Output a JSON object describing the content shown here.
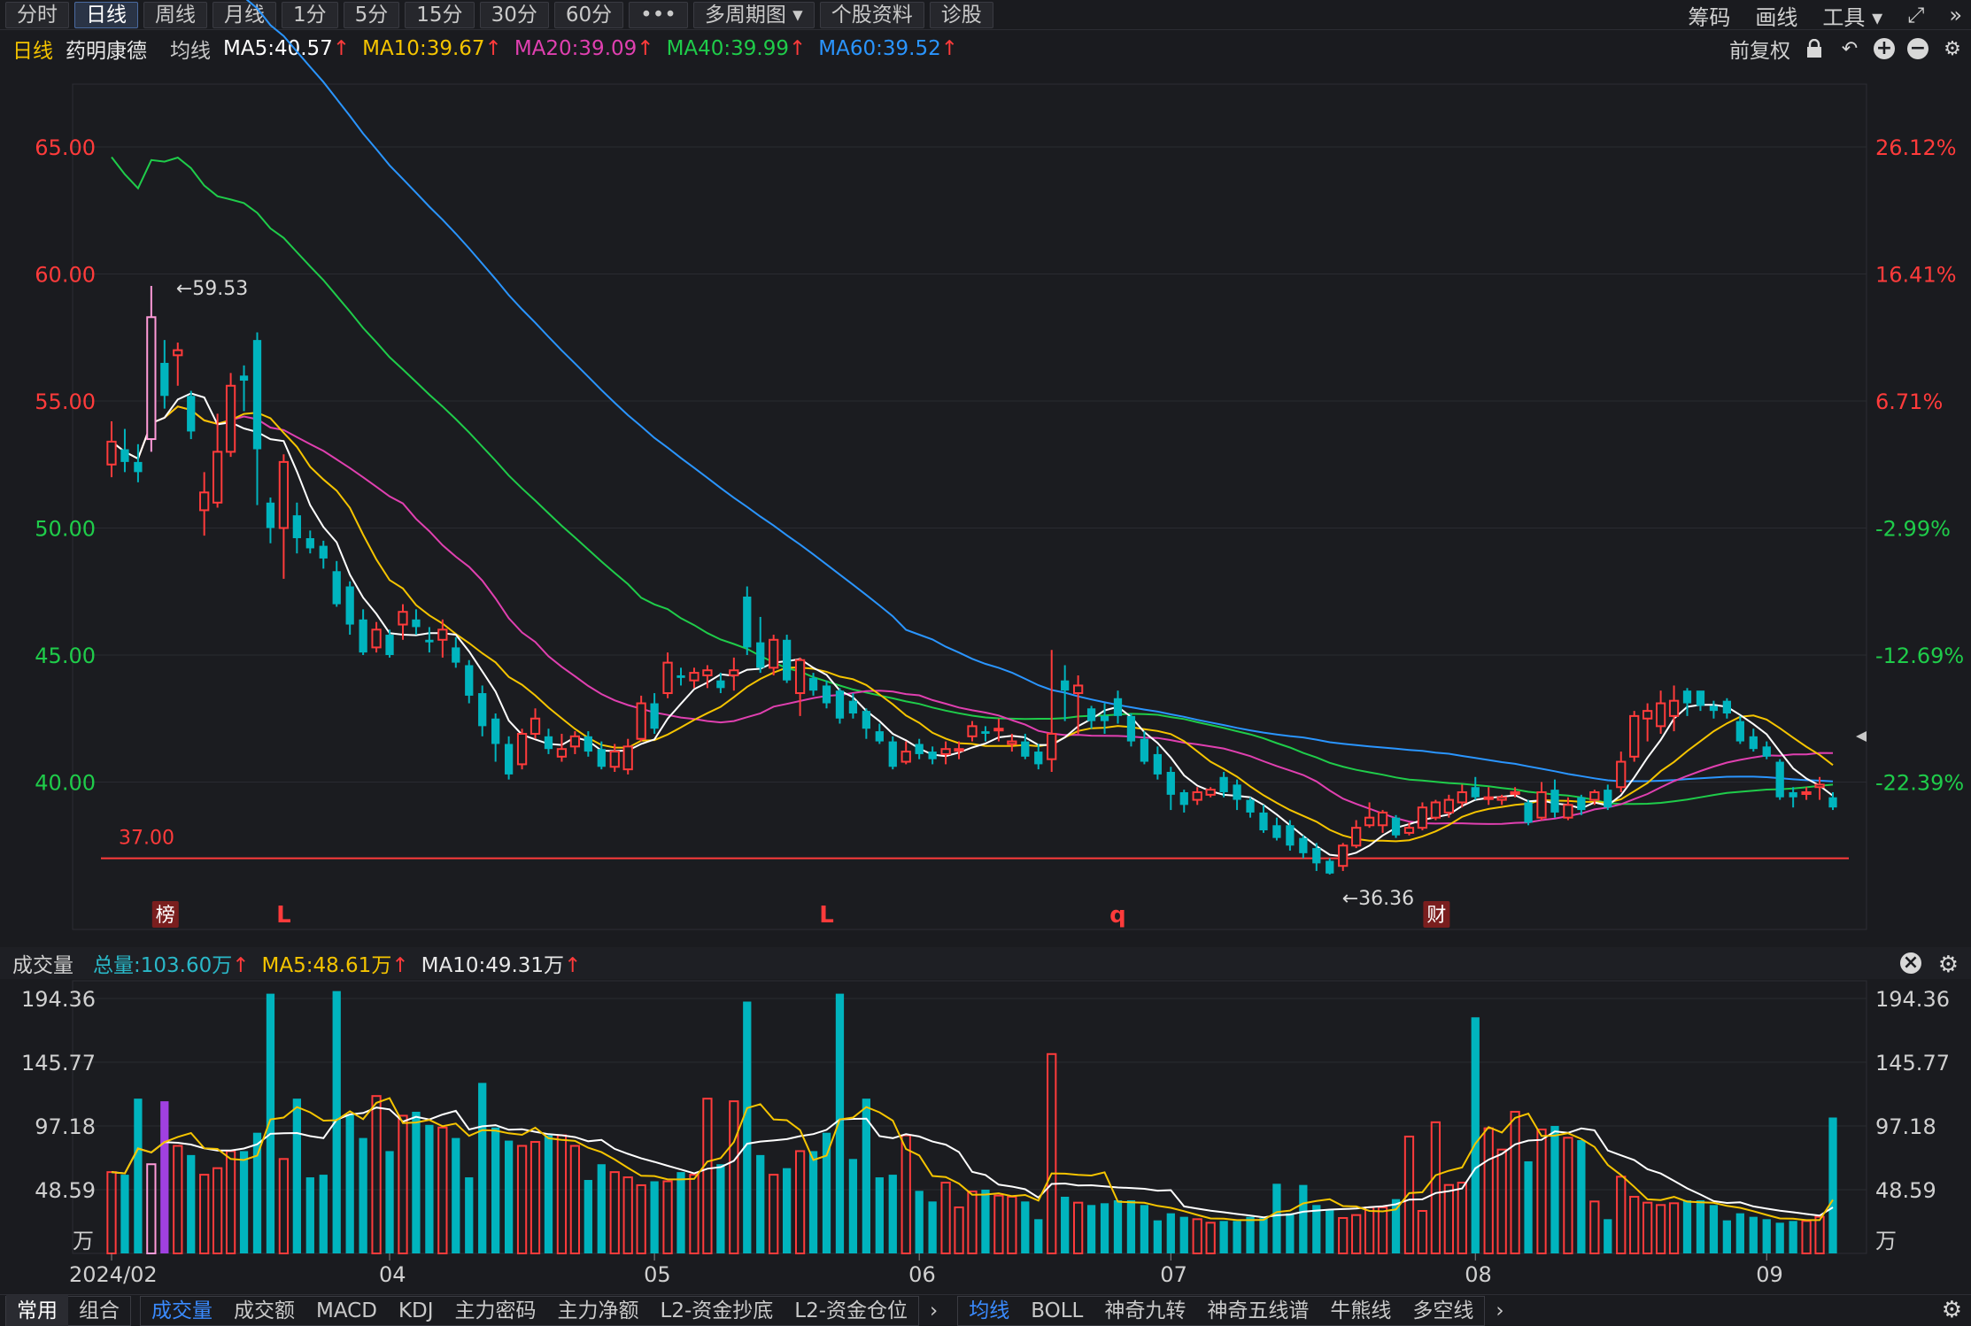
{
  "toolbar": {
    "periods": [
      "分时",
      "日线",
      "周线",
      "月线",
      "1分",
      "5分",
      "15分",
      "30分",
      "60分",
      "•••",
      "多周期图",
      "个股资料",
      "诊股"
    ],
    "active_period": "日线",
    "right": [
      "筹码",
      "画线",
      "工具"
    ]
  },
  "ma_row": {
    "period": "日线",
    "stock": "药明康德",
    "avg_label": "均线",
    "items": [
      {
        "text": "MA5:40.57",
        "color": "#ffffff"
      },
      {
        "text": "MA10:39.67",
        "color": "#f5c400"
      },
      {
        "text": "MA20:39.09",
        "color": "#e040b0"
      },
      {
        "text": "MA40:39.99",
        "color": "#1fcc4a"
      },
      {
        "text": "MA60:39.52",
        "color": "#2a95ff"
      }
    ],
    "adjust": "前复权"
  },
  "volume_header": {
    "label": "成交量",
    "total": "总量:103.60万",
    "ma5": "MA5:48.61万",
    "ma10": "MA10:49.31万"
  },
  "bottom_tabs": {
    "group1": [
      "常用",
      "组合"
    ],
    "group2": [
      "成交量",
      "成交额",
      "MACD",
      "KDJ",
      "主力密码",
      "主力净额",
      "L2-资金抄底",
      "L2-资金仓位"
    ],
    "group3": [
      "均线",
      "BOLL",
      "神奇九转",
      "神奇五线谱",
      "牛熊线",
      "多空线"
    ]
  },
  "colors": {
    "up": "#ff3b3b",
    "down": "#00b4be",
    "ma5": "#ffffff",
    "ma10": "#f5c400",
    "ma20": "#e040b0",
    "ma40": "#1fcc4a",
    "ma60": "#2a95ff"
  },
  "chart_data": {
    "type": "candlestick",
    "price_axis": {
      "ticks": [
        65.0,
        60.0,
        55.0,
        50.0,
        45.0,
        40.0
      ],
      "labels": [
        "65.00",
        "60.00",
        "55.00",
        "50.00",
        "45.00",
        "40.00"
      ]
    },
    "pct_axis": {
      "ticks": [
        26.12,
        16.41,
        6.71,
        -2.99,
        -12.69,
        -22.39
      ],
      "labels": [
        "26.12%",
        "16.41%",
        "6.71%",
        "-2.99%",
        "-12.69%",
        "-22.39%"
      ]
    },
    "support_line": {
      "value": 37.0,
      "label": "37.00"
    },
    "annotations": [
      {
        "text": "←59.53",
        "value": 59.53
      },
      {
        "text": "←36.36",
        "value": 36.36
      }
    ],
    "markers": [
      {
        "text": "榜",
        "boxed": true
      },
      {
        "text": "L",
        "boxed": false
      },
      {
        "text": "L",
        "boxed": false
      },
      {
        "text": "q",
        "boxed": false
      },
      {
        "text": "财",
        "boxed": true
      }
    ],
    "marker_index": [
      4,
      13,
      54,
      76,
      100
    ],
    "x_labels": [
      {
        "i": 0,
        "text": "2024/02"
      },
      {
        "i": 21,
        "text": "04"
      },
      {
        "i": 41,
        "text": "05"
      },
      {
        "i": 61,
        "text": "06"
      },
      {
        "i": 80,
        "text": "07"
      },
      {
        "i": 103,
        "text": "08"
      },
      {
        "i": 125,
        "text": "09"
      }
    ],
    "volume_axis": {
      "ticks": [
        194.36,
        145.77,
        97.18,
        48.59
      ],
      "labels": [
        "194.36",
        "145.77",
        "97.18",
        "48.59"
      ],
      "unit": "万"
    },
    "candles": [
      [
        52.5,
        53.4,
        52.0,
        54.2
      ],
      [
        53.1,
        52.6,
        52.2,
        53.9
      ],
      [
        52.6,
        52.2,
        51.8,
        53.3
      ],
      [
        53.5,
        58.3,
        53.0,
        59.53
      ],
      [
        56.5,
        55.2,
        54.7,
        57.4
      ],
      [
        56.8,
        57.0,
        55.6,
        57.3
      ],
      [
        55.2,
        53.8,
        53.5,
        55.4
      ],
      [
        50.7,
        51.4,
        49.7,
        52.2
      ],
      [
        51.0,
        53.0,
        50.8,
        54.5
      ],
      [
        53.0,
        55.6,
        52.8,
        56.1
      ],
      [
        56.0,
        55.8,
        54.6,
        56.4
      ],
      [
        57.4,
        53.1,
        50.9,
        57.7
      ],
      [
        51.0,
        50.0,
        49.4,
        51.2
      ],
      [
        50.0,
        52.6,
        48.0,
        52.9
      ],
      [
        50.5,
        49.6,
        49.0,
        51.0
      ],
      [
        49.6,
        49.2,
        49.0,
        49.9
      ],
      [
        49.3,
        48.8,
        48.4,
        49.5
      ],
      [
        48.3,
        47.0,
        46.9,
        48.7
      ],
      [
        47.7,
        46.2,
        45.8,
        47.9
      ],
      [
        46.4,
        45.1,
        45.0,
        46.8
      ],
      [
        45.3,
        46.0,
        45.1,
        46.3
      ],
      [
        45.8,
        45.0,
        44.9,
        46.0
      ],
      [
        46.2,
        46.7,
        45.6,
        47.0
      ],
      [
        46.4,
        46.1,
        45.8,
        46.8
      ],
      [
        45.6,
        45.5,
        45.1,
        46.1
      ],
      [
        45.6,
        46.0,
        44.9,
        46.4
      ],
      [
        45.3,
        44.7,
        44.5,
        45.7
      ],
      [
        44.6,
        43.4,
        43.1,
        44.8
      ],
      [
        43.5,
        42.2,
        41.8,
        43.8
      ],
      [
        42.5,
        41.5,
        40.8,
        42.7
      ],
      [
        41.5,
        40.3,
        40.1,
        41.8
      ],
      [
        40.7,
        41.9,
        40.5,
        42.1
      ],
      [
        41.9,
        42.5,
        41.7,
        42.9
      ],
      [
        41.8,
        41.3,
        41.1,
        42.1
      ],
      [
        41.0,
        41.3,
        40.8,
        41.9
      ],
      [
        41.4,
        41.8,
        41.1,
        42.0
      ],
      [
        41.8,
        41.2,
        41.0,
        42.0
      ],
      [
        41.3,
        40.6,
        40.5,
        41.6
      ],
      [
        40.6,
        41.2,
        40.4,
        41.5
      ],
      [
        40.5,
        41.4,
        40.3,
        41.7
      ],
      [
        41.7,
        43.1,
        41.6,
        43.4
      ],
      [
        43.1,
        42.1,
        41.9,
        43.5
      ],
      [
        43.5,
        44.7,
        43.3,
        45.1
      ],
      [
        44.2,
        44.1,
        43.8,
        44.5
      ],
      [
        44.0,
        44.3,
        43.7,
        44.5
      ],
      [
        44.2,
        44.4,
        43.7,
        44.6
      ],
      [
        44.0,
        43.7,
        43.5,
        44.3
      ],
      [
        44.2,
        44.4,
        43.6,
        44.9
      ],
      [
        47.3,
        45.3,
        45.0,
        47.7
      ],
      [
        45.5,
        44.5,
        44.3,
        46.5
      ],
      [
        44.5,
        45.6,
        44.2,
        45.8
      ],
      [
        45.6,
        44.0,
        43.9,
        45.8
      ],
      [
        43.5,
        44.8,
        42.6,
        44.9
      ],
      [
        44.1,
        43.6,
        43.4,
        44.3
      ],
      [
        43.8,
        43.1,
        42.9,
        44.0
      ],
      [
        43.6,
        42.5,
        42.3,
        43.7
      ],
      [
        43.2,
        42.7,
        42.5,
        43.5
      ],
      [
        42.8,
        42.1,
        41.7,
        42.9
      ],
      [
        42.0,
        41.6,
        41.5,
        42.3
      ],
      [
        41.6,
        40.6,
        40.5,
        41.8
      ],
      [
        40.8,
        41.2,
        40.7,
        41.6
      ],
      [
        41.5,
        41.1,
        40.9,
        41.7
      ],
      [
        41.2,
        40.9,
        40.7,
        41.4
      ],
      [
        41.1,
        41.3,
        40.7,
        41.6
      ],
      [
        41.3,
        41.3,
        40.9,
        41.6
      ],
      [
        41.8,
        42.2,
        41.6,
        42.4
      ],
      [
        42.0,
        41.9,
        41.6,
        42.2
      ],
      [
        42.1,
        42.1,
        41.6,
        42.5
      ],
      [
        41.5,
        41.6,
        41.2,
        41.9
      ],
      [
        41.6,
        41.0,
        40.9,
        41.9
      ],
      [
        41.2,
        40.7,
        40.5,
        41.5
      ],
      [
        40.9,
        41.9,
        40.4,
        45.2
      ],
      [
        44.0,
        43.6,
        42.4,
        44.6
      ],
      [
        43.5,
        43.8,
        41.9,
        44.2
      ],
      [
        42.9,
        42.4,
        42.1,
        43.0
      ],
      [
        42.6,
        42.4,
        41.9,
        43.1
      ],
      [
        43.3,
        42.6,
        42.3,
        43.6
      ],
      [
        42.6,
        41.6,
        41.4,
        42.7
      ],
      [
        41.7,
        40.8,
        40.7,
        42.0
      ],
      [
        41.1,
        40.3,
        40.1,
        41.4
      ],
      [
        40.4,
        39.5,
        38.9,
        40.6
      ],
      [
        39.6,
        39.1,
        38.8,
        39.7
      ],
      [
        39.3,
        39.6,
        39.1,
        39.8
      ],
      [
        39.5,
        39.7,
        39.4,
        39.8
      ],
      [
        40.2,
        39.6,
        39.4,
        40.4
      ],
      [
        39.9,
        39.3,
        38.9,
        40.1
      ],
      [
        39.3,
        38.8,
        38.6,
        39.4
      ],
      [
        38.8,
        38.1,
        38.0,
        39.1
      ],
      [
        38.3,
        37.8,
        37.7,
        38.6
      ],
      [
        38.3,
        37.5,
        37.3,
        38.5
      ],
      [
        37.8,
        37.2,
        37.0,
        37.9
      ],
      [
        37.4,
        36.8,
        36.5,
        37.6
      ],
      [
        36.9,
        36.4,
        36.36,
        37.0
      ],
      [
        36.7,
        37.5,
        36.5,
        37.6
      ],
      [
        37.5,
        38.2,
        37.4,
        38.5
      ],
      [
        38.3,
        38.6,
        38.2,
        39.2
      ],
      [
        38.3,
        38.8,
        38.0,
        38.9
      ],
      [
        38.6,
        37.9,
        37.8,
        38.7
      ],
      [
        38.0,
        38.2,
        37.9,
        38.4
      ],
      [
        38.2,
        39.0,
        38.1,
        39.2
      ],
      [
        38.6,
        39.2,
        38.5,
        39.3
      ],
      [
        38.8,
        39.3,
        38.6,
        39.5
      ],
      [
        39.2,
        39.6,
        39.0,
        39.9
      ],
      [
        39.8,
        39.4,
        39.3,
        40.2
      ],
      [
        39.4,
        39.4,
        39.1,
        39.8
      ],
      [
        39.3,
        39.4,
        39.1,
        39.5
      ],
      [
        39.6,
        39.6,
        39.4,
        39.8
      ],
      [
        39.2,
        38.4,
        38.3,
        39.3
      ],
      [
        38.6,
        39.6,
        38.5,
        40.0
      ],
      [
        39.7,
        38.8,
        38.6,
        40.1
      ],
      [
        38.6,
        39.1,
        38.5,
        39.4
      ],
      [
        39.4,
        38.9,
        38.7,
        39.5
      ],
      [
        39.3,
        39.6,
        39.1,
        39.7
      ],
      [
        39.7,
        39.0,
        38.9,
        39.9
      ],
      [
        39.8,
        40.8,
        39.6,
        41.2
      ],
      [
        41.0,
        42.6,
        40.8,
        42.8
      ],
      [
        42.5,
        42.8,
        41.6,
        43.1
      ],
      [
        42.2,
        43.1,
        41.9,
        43.6
      ],
      [
        42.6,
        43.2,
        42.0,
        43.8
      ],
      [
        43.6,
        43.1,
        42.6,
        43.7
      ],
      [
        43.6,
        43.0,
        42.8,
        43.5
      ],
      [
        43.0,
        42.8,
        42.5,
        43.2
      ],
      [
        43.2,
        42.7,
        42.5,
        43.3
      ],
      [
        42.4,
        41.6,
        41.5,
        42.6
      ],
      [
        41.8,
        41.3,
        41.2,
        42.1
      ],
      [
        41.4,
        41.0,
        40.9,
        41.6
      ],
      [
        40.8,
        39.4,
        39.3,
        40.9
      ],
      [
        39.6,
        39.4,
        39.0,
        39.8
      ],
      [
        39.6,
        39.6,
        39.3,
        39.8
      ],
      [
        39.8,
        39.9,
        39.3,
        40.2
      ],
      [
        39.4,
        39.0,
        38.9,
        39.6
      ]
    ],
    "volumes": [
      62,
      60,
      118,
      68,
      116,
      82,
      75,
      60,
      65,
      78,
      78,
      92,
      198,
      72,
      118,
      58,
      60,
      200,
      106,
      88,
      120,
      78,
      105,
      108,
      98,
      96,
      88,
      58,
      130,
      96,
      86,
      82,
      85,
      90,
      90,
      82,
      56,
      68,
      62,
      58,
      52,
      55,
      55
    ],
    "volume_up": [
      1,
      1,
      1,
      0,
      1,
      0,
      1,
      0,
      0,
      1,
      1,
      0,
      0,
      1,
      1,
      0,
      0,
      0,
      1,
      0,
      1,
      1,
      0,
      1,
      0,
      1,
      0,
      0,
      1,
      0,
      0,
      1,
      1,
      1,
      0,
      1,
      0,
      0,
      1,
      1,
      1,
      1,
      0
    ],
    "volume_overlay_note": ""
  }
}
